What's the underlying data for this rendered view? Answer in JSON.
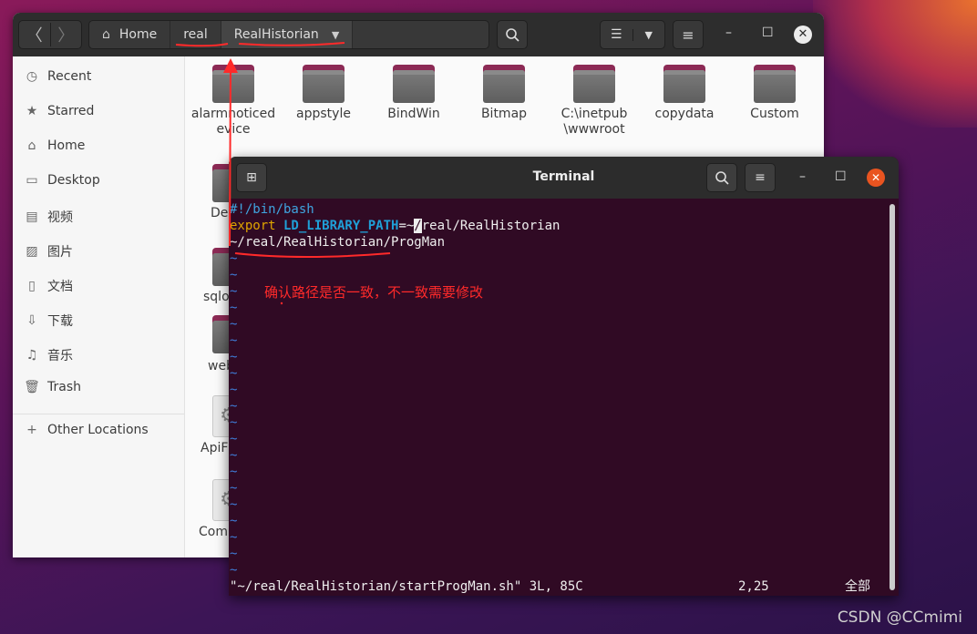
{
  "files": {
    "nav": {
      "back": "〈",
      "forward": "〉"
    },
    "path": {
      "home": "Home",
      "crumb1": "real",
      "crumb2": "RealHistorian",
      "dropdown": "▼"
    },
    "sidebar": [
      {
        "icon": "◷",
        "label": "Recent"
      },
      {
        "icon": "★",
        "label": "Starred"
      },
      {
        "icon": "⌂",
        "label": "Home"
      },
      {
        "icon": "▭",
        "label": "Desktop"
      },
      {
        "icon": "▤",
        "label": "视频"
      },
      {
        "icon": "▨",
        "label": "图片"
      },
      {
        "icon": "▯",
        "label": "文档"
      },
      {
        "icon": "⇩",
        "label": "下载"
      },
      {
        "icon": "♫",
        "label": "音乐"
      },
      {
        "icon": "🗑",
        "label": "Trash"
      },
      {
        "icon": "+",
        "label": "Other Locations"
      }
    ],
    "folders": [
      "alarmnoticedevice",
      "appstyle",
      "BindWin",
      "Bitmap",
      "C:\\inetpub\\wwwroot",
      "copydata",
      "Custom"
    ],
    "partial": [
      "De",
      "sqlo",
      "web",
      "ApiF",
      "Com"
    ]
  },
  "terminal": {
    "title": "Terminal",
    "lines": {
      "l1": "#!/bin/bash",
      "l2a": "export",
      "l2b": " LD_LIBRARY_PATH",
      "l2c": "=~",
      "l2d": "/",
      "l2e": "real/RealHistorian",
      "l3": "~/real/RealHistorian/ProgMan",
      "tilde": "~"
    },
    "status": {
      "file": "\"~/real/RealHistorian/startProgMan.sh\" 3L, 85C",
      "pos": "2,25",
      "all": "全部"
    }
  },
  "annotation": "确认路径是否一致，不一致需要修改",
  "watermark": "CSDN @CCmimi",
  "colors": {
    "terminal_bg": "#300a24",
    "comment": "#3fa5e0",
    "keyword": "#e0a500",
    "var": "#1fa0d8",
    "annotation": "#ff2a2a"
  }
}
